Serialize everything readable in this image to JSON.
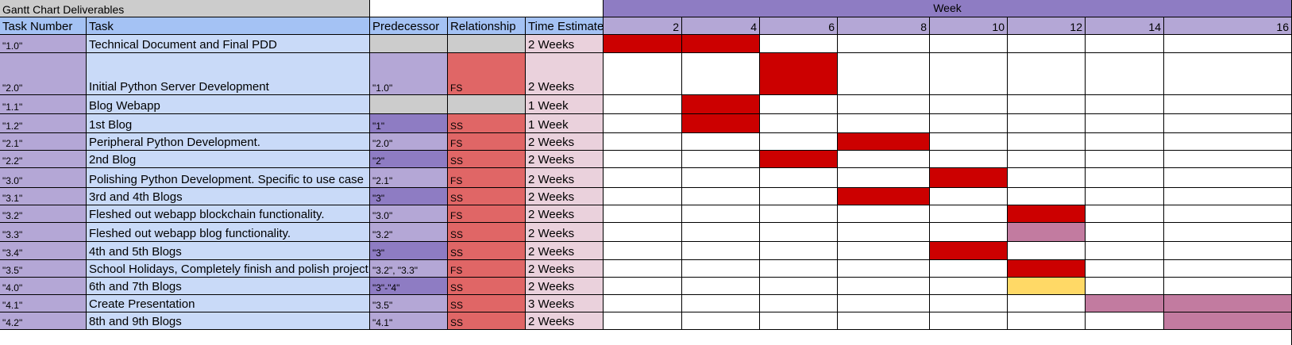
{
  "title": "Gantt Chart Deliverables",
  "week_header": "Week",
  "columns": {
    "task_number": "Task Number",
    "task": "Task",
    "predecessor": "Predecessor",
    "relationship": "Relationship",
    "time_estimate": "Time Estimate"
  },
  "week_labels": [
    "2",
    "4",
    "6",
    "8",
    "10",
    "12",
    "14",
    "16"
  ],
  "colors": {
    "header_purple": "#8e7cc3",
    "week_cells": "#b4a7d6",
    "header_blue": "#a4c2f4",
    "task_blue": "#c9daf8",
    "number_purple": "#b4a7d6",
    "pred_dark": "#8e7cc3",
    "rel_red": "#e06666",
    "time_pink": "#ead1dc",
    "empty_grey": "#cccccc",
    "bar_red": "#cc0000",
    "bar_mauve": "#c27ba0",
    "bar_yellow": "#ffd966"
  },
  "rows": [
    {
      "num": "\"1.0\"",
      "task": "Technical Document and Final PDD",
      "pred": "",
      "rel": "",
      "time": "2 Weeks",
      "pred_style": "empty",
      "rel_style": "empty",
      "bars": [
        [
          0,
          "red"
        ],
        [
          1,
          "red"
        ]
      ]
    },
    {
      "num": "\"2.0\"",
      "task": "Initial Python Server Development",
      "pred": "\"1.0\"",
      "rel": "FS",
      "time": "2 Weeks",
      "pred_style": "light",
      "rel_style": "red",
      "bars": [
        [
          2,
          "red"
        ]
      ]
    },
    {
      "num": "\"1.1\"",
      "task": "Blog Webapp",
      "pred": "",
      "rel": "",
      "time": "1 Week",
      "pred_style": "empty",
      "rel_style": "empty",
      "bars": [
        [
          1,
          "red"
        ]
      ]
    },
    {
      "num": "\"1.2\"",
      "task": "1st Blog",
      "pred": "\"1\"",
      "rel": "SS",
      "time": "1 Week",
      "pred_style": "dark",
      "rel_style": "red",
      "bars": [
        [
          1,
          "red"
        ]
      ]
    },
    {
      "num": "\"2.1\"",
      "task": "Peripheral Python Development.",
      "pred": "\"2.0\"",
      "rel": "FS",
      "time": "2 Weeks",
      "pred_style": "light",
      "rel_style": "red",
      "bars": [
        [
          3,
          "red"
        ]
      ]
    },
    {
      "num": "\"2.2\"",
      "task": "2nd Blog",
      "pred": "\"2\"",
      "rel": "SS",
      "time": "2 Weeks",
      "pred_style": "dark",
      "rel_style": "red",
      "bars": [
        [
          2,
          "red"
        ]
      ]
    },
    {
      "num": "\"3.0\"",
      "task": "Polishing Python Development.  Specific to use case",
      "pred": "\"2.1\"",
      "rel": "FS",
      "time": "2 Weeks",
      "pred_style": "light",
      "rel_style": "red",
      "bars": [
        [
          4,
          "red"
        ]
      ]
    },
    {
      "num": "\"3.1\"",
      "task": "3rd and 4th Blogs",
      "pred": "\"3\"",
      "rel": "SS",
      "time": "2 Weeks",
      "pred_style": "dark",
      "rel_style": "red",
      "bars": [
        [
          3,
          "red"
        ]
      ]
    },
    {
      "num": "\"3.2\"",
      "task": "Fleshed out webapp blockchain functionality.",
      "pred": "\"3.0\"",
      "rel": "FS",
      "time": "2 Weeks",
      "pred_style": "light",
      "rel_style": "red",
      "bars": [
        [
          5,
          "red"
        ]
      ]
    },
    {
      "num": "\"3.3\"",
      "task": "Fleshed out webapp blog functionality.",
      "pred": "\"3.2\"",
      "rel": "SS",
      "time": "2 Weeks",
      "pred_style": "light",
      "rel_style": "red",
      "bars": [
        [
          5,
          "mauve"
        ]
      ]
    },
    {
      "num": "\"3.4\"",
      "task": "4th and 5th Blogs",
      "pred": "\"3\"",
      "rel": "SS",
      "time": "2 Weeks",
      "pred_style": "dark",
      "rel_style": "red",
      "bars": [
        [
          4,
          "red"
        ]
      ]
    },
    {
      "num": "\"3.5\"",
      "task": "School Holidays, Completely finish and polish project",
      "pred": "\"3.2\", \"3.3\"",
      "rel": "FS",
      "time": "2 Weeks",
      "pred_style": "light",
      "rel_style": "red",
      "bars": [
        [
          5,
          "red"
        ]
      ]
    },
    {
      "num": "\"4.0\"",
      "task": "6th and 7th Blogs",
      "pred": "\"3\"-\"4\"",
      "rel": "SS",
      "time": "2 Weeks",
      "pred_style": "dark",
      "rel_style": "red",
      "bars": [
        [
          5,
          "yellow"
        ]
      ]
    },
    {
      "num": "\"4.1\"",
      "task": "Create Presentation",
      "pred": "\"3.5\"",
      "rel": "SS",
      "time": "3 Weeks",
      "pred_style": "light",
      "rel_style": "red",
      "bars": [
        [
          6,
          "mauve"
        ],
        [
          7,
          "mauve"
        ]
      ]
    },
    {
      "num": "\"4.2\"",
      "task": "8th and 9th Blogs",
      "pred": "\"4.1\"",
      "rel": "SS",
      "time": "2 Weeks",
      "pred_style": "light",
      "rel_style": "red",
      "bars": [
        [
          7,
          "mauve"
        ]
      ]
    }
  ]
}
